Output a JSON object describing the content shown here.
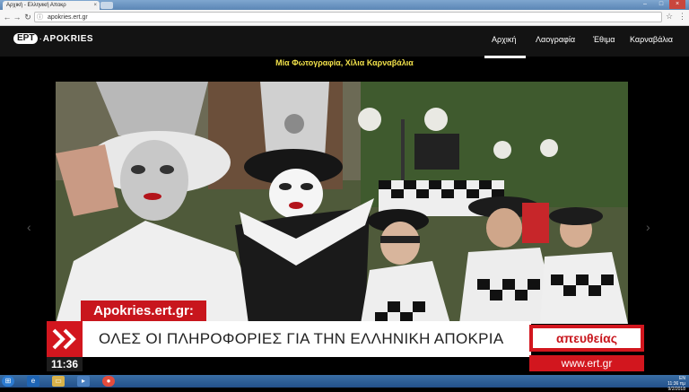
{
  "browser": {
    "tab_title": "Αρχική - Ελληνική Αποκρ",
    "tab_close": "×",
    "url": "apokries.ert.gr",
    "controls": {
      "minimize": "–",
      "maximize": "□",
      "close": "×"
    },
    "icons": [
      "back-icon",
      "forward-icon",
      "reload-icon",
      "star-icon",
      "menu-icon"
    ]
  },
  "site": {
    "logo": {
      "badge": "ΕΡΤ",
      "dot": "·",
      "name": "APOKRIES"
    },
    "nav": [
      "Αρχική",
      "Λαογραφία",
      "Έθιμα",
      "Καρναβάλια"
    ],
    "nav_active": "Αρχική",
    "subtitle": "Μία Φωτογραφία, Χίλια Καρναβάλια"
  },
  "overlay": {
    "tag": "Apokries.ert.gr:",
    "headline": "ΟΛΕΣ ΟΙ ΠΛΗΡΟΦΟΡΙΕΣ ΓΙΑ ΤΗΝ ΕΛΛΗΝΙΚΗ ΑΠΟΚΡΙΑ",
    "live": "απευθείας",
    "site_url": "www.ert.gr",
    "time": "11:36"
  },
  "taskbar": {
    "tray_time": "11:36 πμ",
    "tray_date": "9/2/2018",
    "tray_lang": "EN"
  },
  "colors": {
    "accent_red": "#d2161e",
    "subtitle_yellow": "#f0e04a",
    "header_bg": "#131313"
  }
}
